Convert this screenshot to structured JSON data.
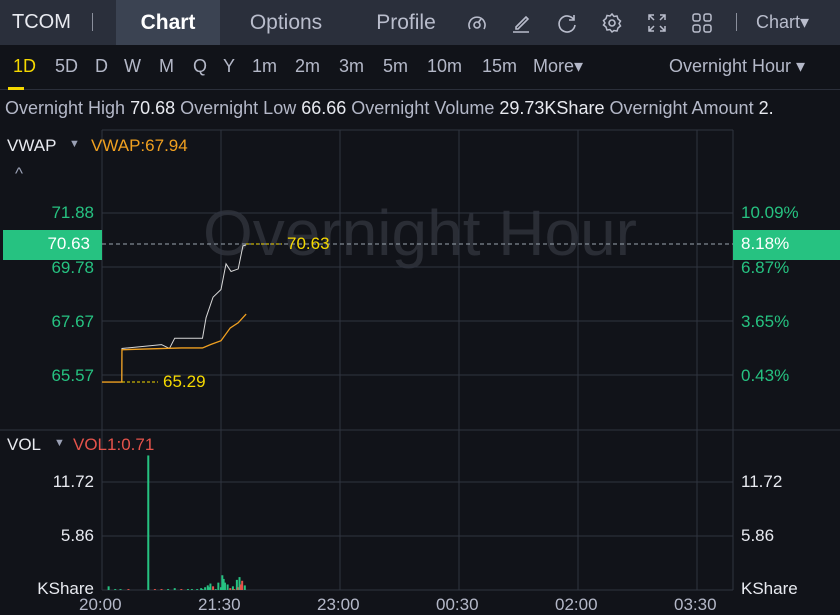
{
  "header": {
    "symbol": "TCOM",
    "tabs": [
      "Chart",
      "Options",
      "Profile"
    ],
    "active_tab": "Chart",
    "icons": [
      "gauge-icon",
      "draw-icon",
      "refresh-icon",
      "settings-icon",
      "fullscreen-icon",
      "layout-grid-icon"
    ],
    "chart_type": "Chart▾"
  },
  "periods": {
    "items": [
      "1D",
      "5D",
      "D",
      "W",
      "M",
      "Q",
      "Y",
      "1m",
      "2m",
      "3m",
      "5m",
      "10m",
      "15m",
      "More▾"
    ],
    "active": "1D",
    "session": "Overnight Hour ▾"
  },
  "stats": [
    {
      "label": "Overnight High",
      "value": "70.68"
    },
    {
      "label": "Overnight Low",
      "value": "66.66"
    },
    {
      "label": "Overnight Volume",
      "value": "29.73KShare"
    },
    {
      "label": "Overnight Amount",
      "value": "2."
    }
  ],
  "main": {
    "indicator": "VWAP",
    "indicator_value": "VWAP:67.94",
    "watermark": "Overnight Hour",
    "collapse": "^",
    "current_price": "70.63",
    "current_pct": "8.18%",
    "high_label": "70.63",
    "low_label": "65.29",
    "left_ticks": [
      "71.88",
      "69.78",
      "67.67",
      "65.57"
    ],
    "right_ticks": [
      "10.09%",
      "6.87%",
      "3.65%",
      "0.43%"
    ]
  },
  "volume": {
    "indicator": "VOL",
    "indicator_value": "VOL1:0.71",
    "left_ticks": [
      "11.72",
      "5.86",
      "KShare"
    ],
    "right_ticks": [
      "11.72",
      "5.86",
      "KShare"
    ]
  },
  "x_ticks": [
    "20:00",
    "21:30",
    "23:00",
    "00:30",
    "02:00",
    "03:30"
  ],
  "colors": {
    "up": "#26c281",
    "down": "#e5534b",
    "vwap": "#f0a020",
    "price": "#d8d8d8",
    "accent": "#f5d800"
  },
  "chart_data": [
    {
      "type": "line",
      "y_ticks": [
        71.88,
        69.78,
        67.67,
        65.57
      ],
      "series": [
        {
          "name": "price",
          "x_minutes_from_20_00": [
            0,
            15,
            15.1,
            45,
            51,
            55,
            76,
            78.7,
            84,
            90,
            93.8,
            97.6,
            103,
            106.6,
            108.9
          ],
          "values": [
            65.29,
            65.29,
            66.6,
            66.75,
            66.6,
            67.0,
            67.0,
            67.8,
            68.6,
            68.9,
            69.9,
            69.6,
            69.7,
            70.6,
            70.63
          ]
        },
        {
          "name": "VWAP",
          "x_minutes_from_20_00": [
            0,
            15,
            15.1,
            60,
            76,
            82,
            90,
            97,
            103,
            109
          ],
          "values": [
            65.29,
            65.29,
            66.55,
            66.62,
            66.62,
            66.75,
            66.9,
            67.4,
            67.6,
            67.94
          ]
        }
      ]
    },
    {
      "type": "bar",
      "title": "VOL",
      "y_ticks": [
        11.72,
        5.86
      ],
      "unit": "KShare",
      "x_minutes_from_20_00": [
        5,
        10,
        14,
        20,
        35,
        40,
        45,
        50,
        55,
        60,
        65,
        68,
        72,
        75,
        76,
        78,
        80,
        81,
        82,
        84,
        86,
        88,
        90,
        91,
        92,
        93,
        95,
        97,
        99,
        100,
        102,
        103,
        104,
        105,
        106,
        108
      ],
      "values": [
        0.4,
        0.1,
        0.1,
        0.1,
        14.6,
        0.1,
        0.1,
        0.1,
        0.2,
        0.1,
        0.1,
        0.1,
        0.1,
        0.2,
        0.1,
        0.3,
        0.5,
        0.3,
        0.7,
        0.4,
        0.1,
        0.8,
        0.3,
        1.6,
        1.2,
        0.8,
        0.6,
        0.2,
        0.4,
        0.1,
        1.1,
        0.3,
        1.4,
        0.6,
        1.0,
        0.5
      ],
      "colors": [
        "up",
        "up",
        "up",
        "down",
        "up",
        "down",
        "down",
        "up",
        "up",
        "down",
        "up",
        "up",
        "up",
        "up",
        "up",
        "up",
        "up",
        "up",
        "up",
        "down",
        "up",
        "up",
        "up",
        "up",
        "up",
        "up",
        "up",
        "down",
        "up",
        "down",
        "up",
        "down",
        "up",
        "down",
        "down",
        "up"
      ]
    }
  ]
}
